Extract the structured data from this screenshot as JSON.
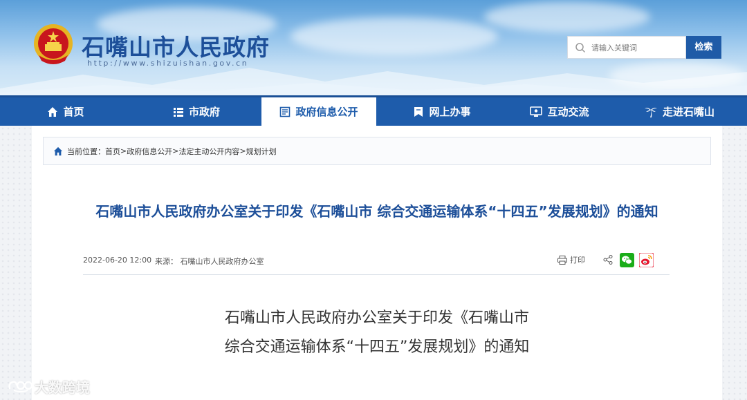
{
  "header": {
    "site_title": "石嘴山市人民政府",
    "site_url": "http://www.shizuishan.gov.cn",
    "search": {
      "placeholder": "请输入关键词",
      "button_label": "检索"
    }
  },
  "nav": {
    "items": [
      {
        "label": "首页",
        "icon": "home-icon",
        "active": false
      },
      {
        "label": "市政府",
        "icon": "list-icon",
        "active": false
      },
      {
        "label": "政府信息公开",
        "icon": "document-icon",
        "active": true
      },
      {
        "label": "网上办事",
        "icon": "bookmark-icon",
        "active": false
      },
      {
        "label": "互动交流",
        "icon": "monitor-icon",
        "active": false
      },
      {
        "label": "走进石嘴山",
        "icon": "palm-tree-icon",
        "active": false
      }
    ]
  },
  "breadcrumb": {
    "prefix": "当前位置：",
    "items": [
      "首页",
      "政府信息公开",
      "法定主动公开内容",
      "规划计划"
    ],
    "separator": " > "
  },
  "article": {
    "title": "石嘴山市人民政府办公室关于印发《石嘴山市 综合交通运输体系“十四五”发展规划》的通知",
    "date": "2022-06-20 12:00",
    "source": "来源： 石嘴山市人民政府办公室",
    "print_label": "打印",
    "body_title_line1": "石嘴山市人民政府办公室关于印发《石嘴山市",
    "body_title_line2": "综合交通运输体系“十四五”发展规划》的通知"
  },
  "watermark": {
    "text": "大数跨境"
  },
  "colors": {
    "brand_blue": "#1e5cab",
    "title_blue": "#1d4f99",
    "emblem_red": "#c8161d",
    "wechat_green": "#1aad19"
  }
}
